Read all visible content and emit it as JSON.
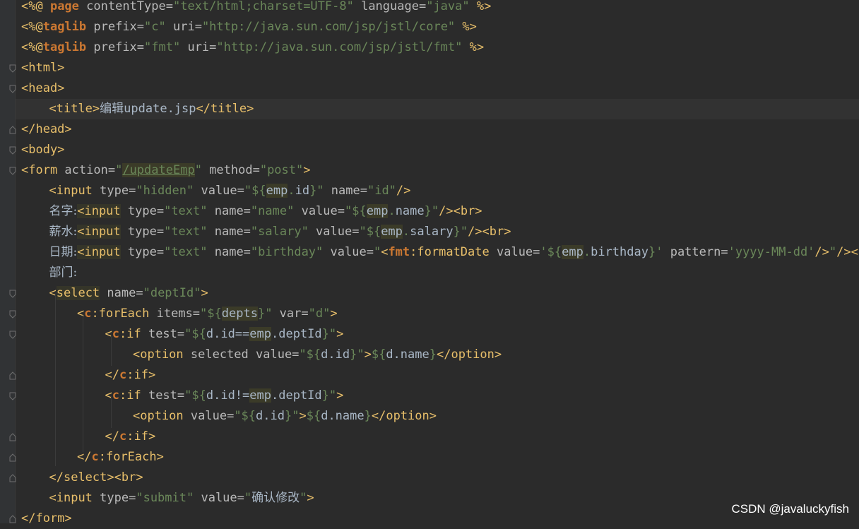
{
  "editor": {
    "lines": [
      {
        "indent": 0,
        "fold": "",
        "segments": [
          [
            "tag",
            "<%@ "
          ],
          [
            "dir",
            "page"
          ],
          [
            "attr",
            " contentType="
          ],
          [
            "str",
            "\"text/html;charset=UTF-8\""
          ],
          [
            "attr",
            " language="
          ],
          [
            "str",
            "\"java\""
          ],
          [
            "tag",
            " %>"
          ]
        ]
      },
      {
        "indent": 0,
        "fold": "",
        "segments": [
          [
            "tag",
            "<%@"
          ],
          [
            "dir",
            "taglib"
          ],
          [
            "attr",
            " prefix="
          ],
          [
            "str",
            "\"c\""
          ],
          [
            "attr",
            " uri="
          ],
          [
            "str",
            "\"http://java.sun.com/jsp/jstl/core\""
          ],
          [
            "tag",
            " %>"
          ]
        ]
      },
      {
        "indent": 0,
        "fold": "",
        "segments": [
          [
            "tag",
            "<%@"
          ],
          [
            "dir",
            "taglib"
          ],
          [
            "attr",
            " prefix="
          ],
          [
            "str",
            "\"fmt\""
          ],
          [
            "attr",
            " uri="
          ],
          [
            "str",
            "\"http://java.sun.com/jsp/jstl/fmt\""
          ],
          [
            "tag",
            " %>"
          ]
        ]
      },
      {
        "indent": 0,
        "fold": "open",
        "segments": [
          [
            "tag",
            "<html>"
          ]
        ]
      },
      {
        "indent": 0,
        "fold": "open",
        "segments": [
          [
            "tag",
            "<head>"
          ]
        ]
      },
      {
        "indent": 1,
        "fold": "",
        "highlight": true,
        "segments": [
          [
            "tag",
            "<title>"
          ],
          [
            "lbl",
            "编辑"
          ],
          [
            "plain",
            "update.jsp"
          ],
          [
            "tag",
            "</title>"
          ]
        ]
      },
      {
        "indent": 0,
        "fold": "close",
        "segments": [
          [
            "tag",
            "</head>"
          ]
        ]
      },
      {
        "indent": 0,
        "fold": "open",
        "segments": [
          [
            "tag",
            "<body>"
          ]
        ]
      },
      {
        "indent": 0,
        "fold": "open",
        "segments": [
          [
            "tag",
            "<form"
          ],
          [
            "attr",
            " action="
          ],
          [
            "str",
            "\""
          ],
          [
            "strlink",
            "/updateEmp"
          ],
          [
            "str",
            "\""
          ],
          [
            "attr",
            " method="
          ],
          [
            "str",
            "\"post\""
          ],
          [
            "tag",
            ">"
          ]
        ]
      },
      {
        "indent": 1,
        "fold": "",
        "segments": [
          [
            "tag",
            "<input"
          ],
          [
            "attr",
            " type="
          ],
          [
            "str",
            "\"hidden\""
          ],
          [
            "attr",
            " value="
          ],
          [
            "str",
            "\"${"
          ],
          [
            "ident",
            "emp"
          ],
          [
            "str",
            "."
          ],
          [
            "plain",
            "id"
          ],
          [
            "str",
            "}\""
          ],
          [
            "attr",
            " name="
          ],
          [
            "str",
            "\"id\""
          ],
          [
            "tag",
            "/>"
          ]
        ]
      },
      {
        "indent": 1,
        "fold": "",
        "segments": [
          [
            "lbl",
            "名字:"
          ],
          [
            "tagbg",
            "<input"
          ],
          [
            "attr",
            " type="
          ],
          [
            "str",
            "\"text\""
          ],
          [
            "attr",
            " name="
          ],
          [
            "str",
            "\"name\""
          ],
          [
            "attr",
            " value="
          ],
          [
            "str",
            "\"${"
          ],
          [
            "ident",
            "emp"
          ],
          [
            "str",
            "."
          ],
          [
            "plain",
            "name"
          ],
          [
            "str",
            "}\""
          ],
          [
            "tag",
            "/><br>"
          ]
        ]
      },
      {
        "indent": 1,
        "fold": "",
        "segments": [
          [
            "lbl",
            "薪水:"
          ],
          [
            "tagbg",
            "<input"
          ],
          [
            "attr",
            " type="
          ],
          [
            "str",
            "\"text\""
          ],
          [
            "attr",
            " name="
          ],
          [
            "str",
            "\"salary\""
          ],
          [
            "attr",
            " value="
          ],
          [
            "str",
            "\"${"
          ],
          [
            "ident",
            "emp"
          ],
          [
            "str",
            "."
          ],
          [
            "plain",
            "salary"
          ],
          [
            "str",
            "}\""
          ],
          [
            "tag",
            "/><br>"
          ]
        ]
      },
      {
        "indent": 1,
        "fold": "",
        "segments": [
          [
            "lbl",
            "日期:"
          ],
          [
            "tagbg",
            "<input"
          ],
          [
            "attr",
            " type="
          ],
          [
            "str",
            "\"text\""
          ],
          [
            "attr",
            " name="
          ],
          [
            "str",
            "\"birthday\""
          ],
          [
            "attr",
            " value="
          ],
          [
            "str",
            "\""
          ],
          [
            "tag",
            "<"
          ],
          [
            "dir",
            "fmt"
          ],
          [
            "tag",
            ":formatDate"
          ],
          [
            "attr",
            " value="
          ],
          [
            "str",
            "'${"
          ],
          [
            "ident",
            "emp"
          ],
          [
            "str",
            "."
          ],
          [
            "plain",
            "birthday"
          ],
          [
            "str",
            "}'"
          ],
          [
            "attr",
            " pattern="
          ],
          [
            "str",
            "'yyyy-MM-dd'"
          ],
          [
            "tag",
            "/>"
          ],
          [
            "str",
            "\""
          ],
          [
            "tag",
            "/><br>"
          ]
        ]
      },
      {
        "indent": 1,
        "fold": "",
        "segments": [
          [
            "lbl",
            "部门:"
          ]
        ]
      },
      {
        "indent": 1,
        "fold": "open",
        "segments": [
          [
            "tag",
            "<"
          ],
          [
            "tagbg",
            "select"
          ],
          [
            "attr",
            " name="
          ],
          [
            "str",
            "\"deptId\""
          ],
          [
            "tag",
            ">"
          ]
        ]
      },
      {
        "indent": 2,
        "fold": "open",
        "segments": [
          [
            "tag",
            "<"
          ],
          [
            "dir",
            "c"
          ],
          [
            "tag",
            ":forEach"
          ],
          [
            "attr",
            " items="
          ],
          [
            "str",
            "\"${"
          ],
          [
            "ident",
            "depts"
          ],
          [
            "str",
            "}\""
          ],
          [
            "attr",
            " var="
          ],
          [
            "str",
            "\"d\""
          ],
          [
            "tag",
            ">"
          ]
        ]
      },
      {
        "indent": 3,
        "fold": "open",
        "segments": [
          [
            "tag",
            "<"
          ],
          [
            "dir",
            "c"
          ],
          [
            "tag",
            ":if"
          ],
          [
            "attr",
            " test="
          ],
          [
            "str",
            "\"${"
          ],
          [
            "plain",
            "d.id=="
          ],
          [
            "ident",
            "emp"
          ],
          [
            "plain",
            ".deptId"
          ],
          [
            "str",
            "}\""
          ],
          [
            "tag",
            ">"
          ]
        ]
      },
      {
        "indent": 4,
        "fold": "",
        "segments": [
          [
            "tag",
            "<option"
          ],
          [
            "attr",
            " selected value="
          ],
          [
            "str",
            "\"${"
          ],
          [
            "plain",
            "d.id"
          ],
          [
            "str",
            "}\""
          ],
          [
            "tag",
            ">"
          ],
          [
            "str",
            "${"
          ],
          [
            "plain",
            "d.name"
          ],
          [
            "str",
            "}"
          ],
          [
            "tag",
            "</option>"
          ]
        ]
      },
      {
        "indent": 3,
        "fold": "close",
        "segments": [
          [
            "tag",
            "</"
          ],
          [
            "dir",
            "c"
          ],
          [
            "tag",
            ":if>"
          ]
        ]
      },
      {
        "indent": 3,
        "fold": "open",
        "segments": [
          [
            "tag",
            "<"
          ],
          [
            "dir",
            "c"
          ],
          [
            "tag",
            ":if"
          ],
          [
            "attr",
            " test="
          ],
          [
            "str",
            "\"${"
          ],
          [
            "plain",
            "d.id!="
          ],
          [
            "ident",
            "emp"
          ],
          [
            "plain",
            ".deptId"
          ],
          [
            "str",
            "}\""
          ],
          [
            "tag",
            ">"
          ]
        ]
      },
      {
        "indent": 4,
        "fold": "",
        "segments": [
          [
            "tag",
            "<option"
          ],
          [
            "attr",
            " value="
          ],
          [
            "str",
            "\"${"
          ],
          [
            "plain",
            "d.id"
          ],
          [
            "str",
            "}\""
          ],
          [
            "tag",
            ">"
          ],
          [
            "str",
            "${"
          ],
          [
            "plain",
            "d.name"
          ],
          [
            "str",
            "}"
          ],
          [
            "tag",
            "</option>"
          ]
        ]
      },
      {
        "indent": 3,
        "fold": "close",
        "segments": [
          [
            "tag",
            "</"
          ],
          [
            "dir",
            "c"
          ],
          [
            "tag",
            ":if>"
          ]
        ]
      },
      {
        "indent": 2,
        "fold": "close",
        "segments": [
          [
            "tag",
            "</"
          ],
          [
            "dir",
            "c"
          ],
          [
            "tag",
            ":forEach>"
          ]
        ]
      },
      {
        "indent": 1,
        "fold": "close",
        "segments": [
          [
            "tag",
            "</select><br>"
          ]
        ]
      },
      {
        "indent": 1,
        "fold": "",
        "segments": [
          [
            "tag",
            "<input"
          ],
          [
            "attr",
            " type="
          ],
          [
            "str",
            "\"submit\""
          ],
          [
            "attr",
            " value="
          ],
          [
            "str",
            "\""
          ],
          [
            "lblstr",
            "确认修改"
          ],
          [
            "str",
            "\""
          ],
          [
            "tag",
            ">"
          ]
        ]
      },
      {
        "indent": 0,
        "fold": "close",
        "segments": [
          [
            "tag",
            "</form>"
          ]
        ]
      }
    ]
  },
  "watermark": "CSDN @javaluckyfish"
}
